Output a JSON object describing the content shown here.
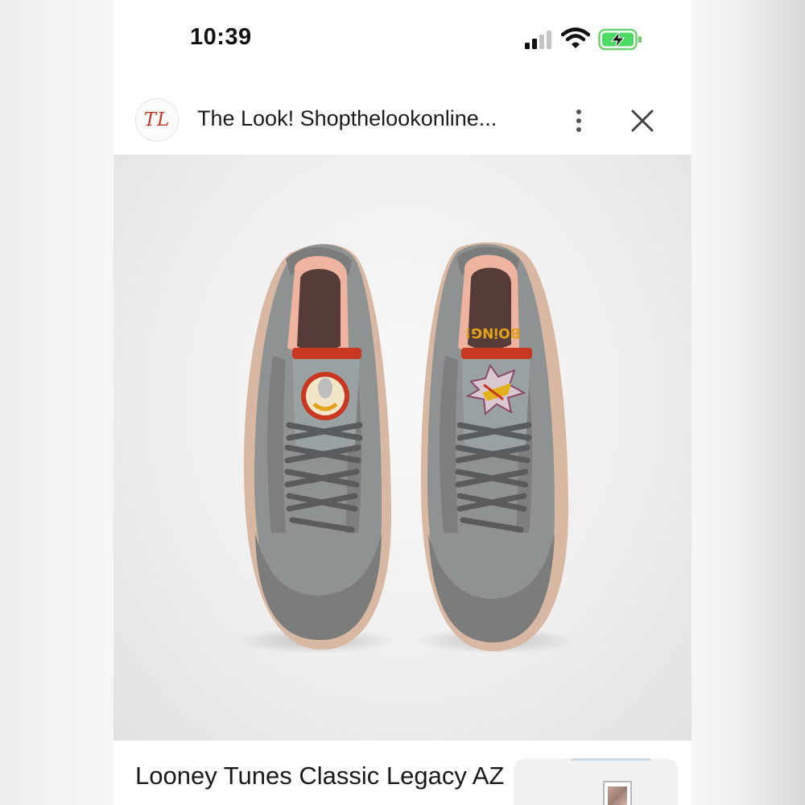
{
  "status_bar": {
    "time": "10:39",
    "icons": [
      "signal-icon",
      "wifi-icon",
      "battery-charging-icon"
    ],
    "battery_color": "#4cd964"
  },
  "header": {
    "site_logo_text": "TL",
    "site_title": "The Look! Shopthelookonline...",
    "more_icon": "more-vertical-icon",
    "close_icon": "close-icon"
  },
  "product": {
    "image_subject": "sneakers-top-view",
    "tongue_text": "BOiNG!",
    "title": "Looney Tunes Classic Legacy AZ"
  },
  "colors": {
    "shoe_gray": "#8f9293",
    "suede_gray": "#7b7c7c",
    "collar_peach": "#efb4a0",
    "tongue_red": "#c8371f",
    "sole_tan": "#d8b8a2"
  }
}
